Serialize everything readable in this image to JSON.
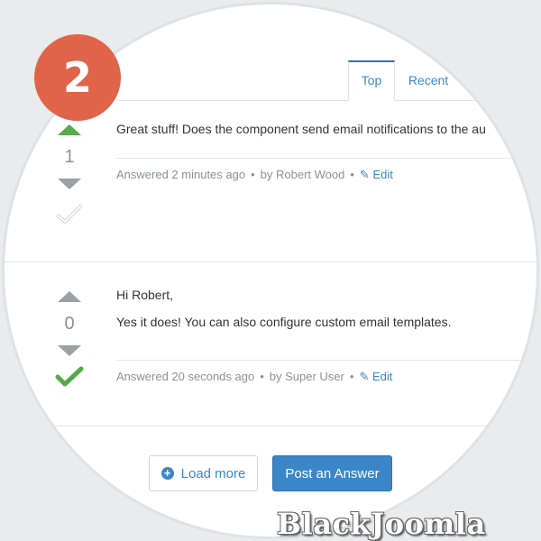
{
  "badge": {
    "number": "2"
  },
  "tabs": [
    {
      "label": "Top",
      "active": true
    },
    {
      "label": "Recent",
      "active": false
    }
  ],
  "answers": [
    {
      "votes": "1",
      "accepted": false,
      "lines": [
        "Great stuff! Does the component send email notifications to the au"
      ],
      "answered": "Answered 2 minutes ago",
      "by": "by Robert Wood",
      "edit": "Edit"
    },
    {
      "votes": "0",
      "accepted": true,
      "lines": [
        "Hi Robert,",
        "Yes it does! You can also configure custom email templates."
      ],
      "answered": "Answered 20 seconds ago",
      "by": "by Super User",
      "edit": "Edit"
    }
  ],
  "actions": {
    "load_more": "Load more",
    "post_answer": "Post an Answer"
  },
  "watermark": "BlackJoomla",
  "colors": {
    "accent": "#3a86c8",
    "badge": "#e0644a",
    "upvote": "#52ad47"
  }
}
